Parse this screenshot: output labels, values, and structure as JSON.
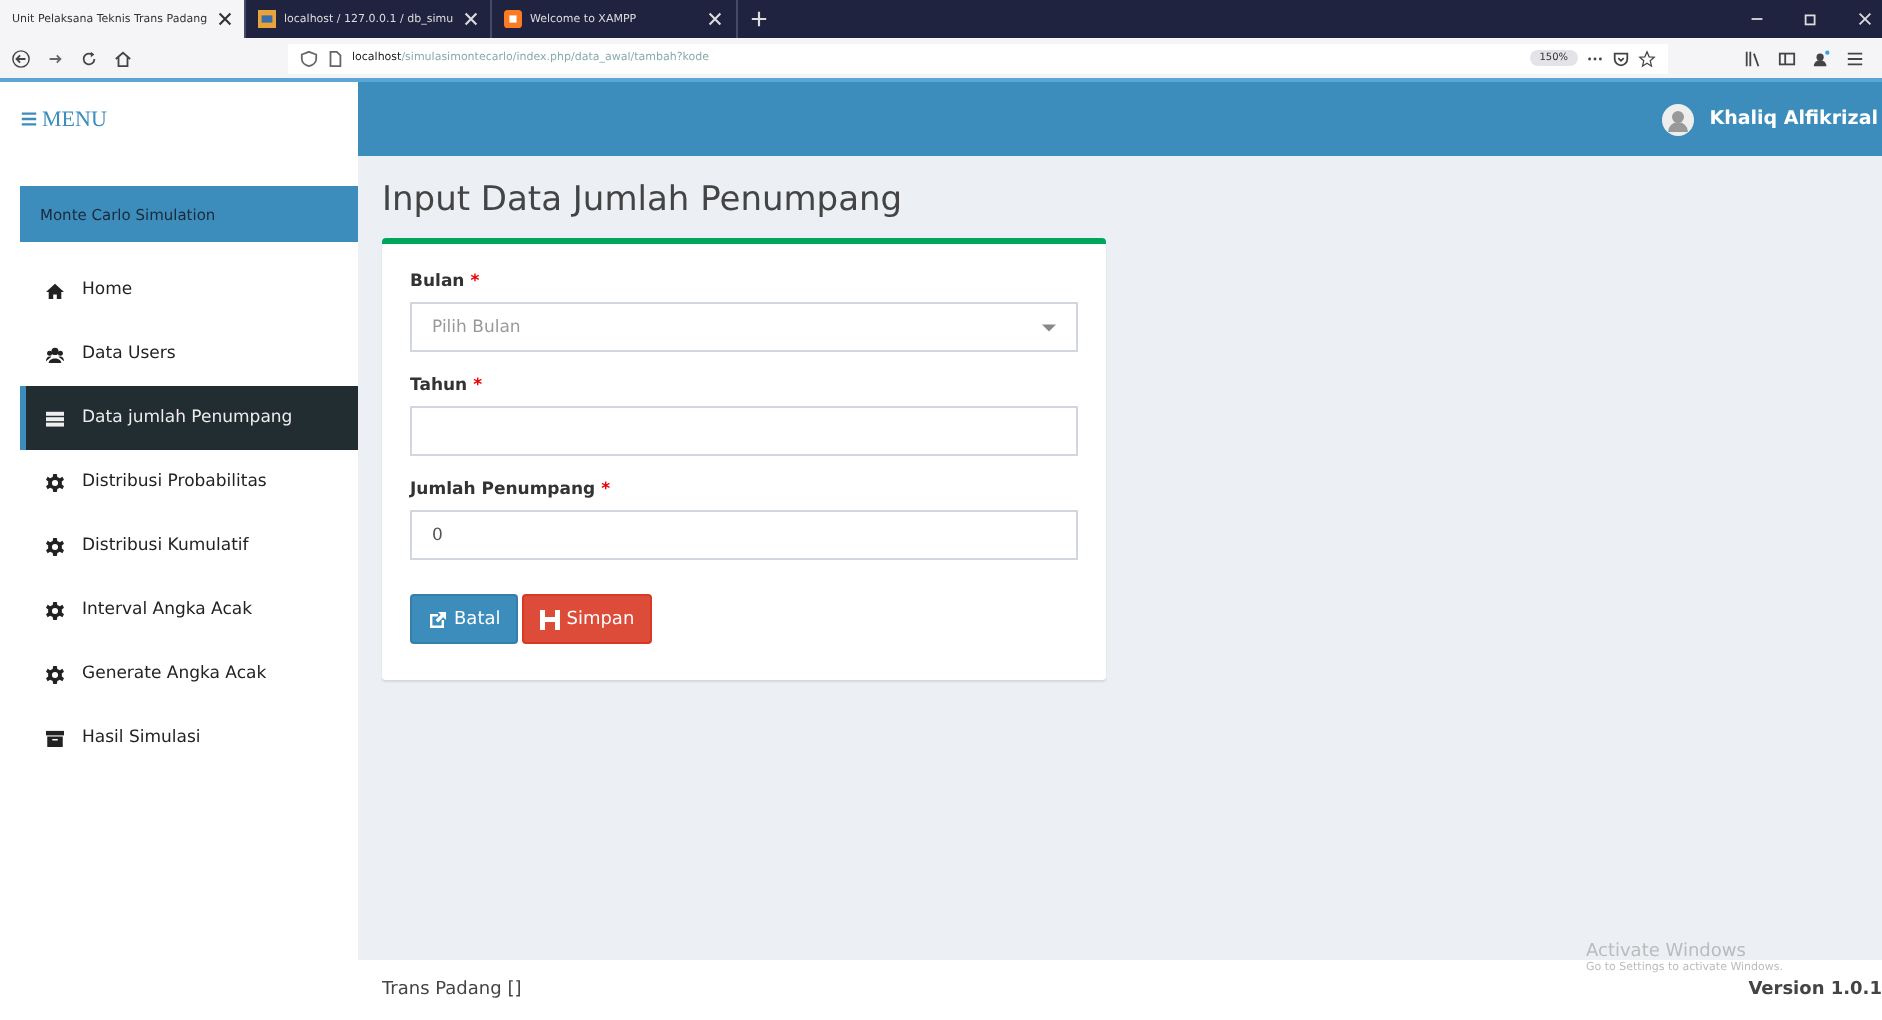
{
  "browser": {
    "tabs": [
      {
        "label": "Unit Pelaksana Teknis Trans Padang",
        "selected": true,
        "kind": "page"
      },
      {
        "label": "localhost / 127.0.0.1 / db_simu",
        "selected": false,
        "kind": "db"
      },
      {
        "label": "Welcome to XAMPP",
        "selected": false,
        "kind": "xampp"
      }
    ],
    "address": {
      "host": "localhost",
      "path": "/simulasimontecarlo/index.php/data_awal/tambah?kode"
    },
    "zoom": "150%"
  },
  "sidebar": {
    "menu_label": "MENU",
    "title": "Monte Carlo Simulation",
    "items": [
      {
        "label": "Home",
        "kind": "home",
        "selected": false
      },
      {
        "label": "Data Users",
        "kind": "users",
        "selected": false
      },
      {
        "label": "Data jumlah Penumpang",
        "kind": "list",
        "selected": true
      },
      {
        "label": "Distribusi Probabilitas",
        "kind": "gear",
        "selected": false
      },
      {
        "label": "Distribusi Kumulatif",
        "kind": "gear",
        "selected": false
      },
      {
        "label": "Interval Angka Acak",
        "kind": "gear",
        "selected": false
      },
      {
        "label": "Generate Angka Acak",
        "kind": "gear",
        "selected": false
      },
      {
        "label": "Hasil Simulasi",
        "kind": "archive",
        "selected": false
      }
    ]
  },
  "header": {
    "user": "Khaliq Alfikrizal"
  },
  "page_title": "Input Data Jumlah Penumpang",
  "form": {
    "fields": [
      {
        "label": "Bulan",
        "required": "*",
        "kind": "select",
        "placeholder": "Pilih Bulan"
      },
      {
        "label": "Tahun",
        "required": "*",
        "kind": "text"
      },
      {
        "label": "Jumlah Penumpang",
        "required": "*",
        "kind": "text",
        "value": "0"
      }
    ],
    "buttons": [
      {
        "label": "Batal",
        "kind": "cancel"
      },
      {
        "label": "Simpan",
        "kind": "save"
      }
    ]
  },
  "footer": {
    "left": "Trans Padang []",
    "right": "Version 1.0.1"
  },
  "os_notice": {
    "title": "Activate Windows",
    "text": "Go to Settings to activate Windows."
  }
}
